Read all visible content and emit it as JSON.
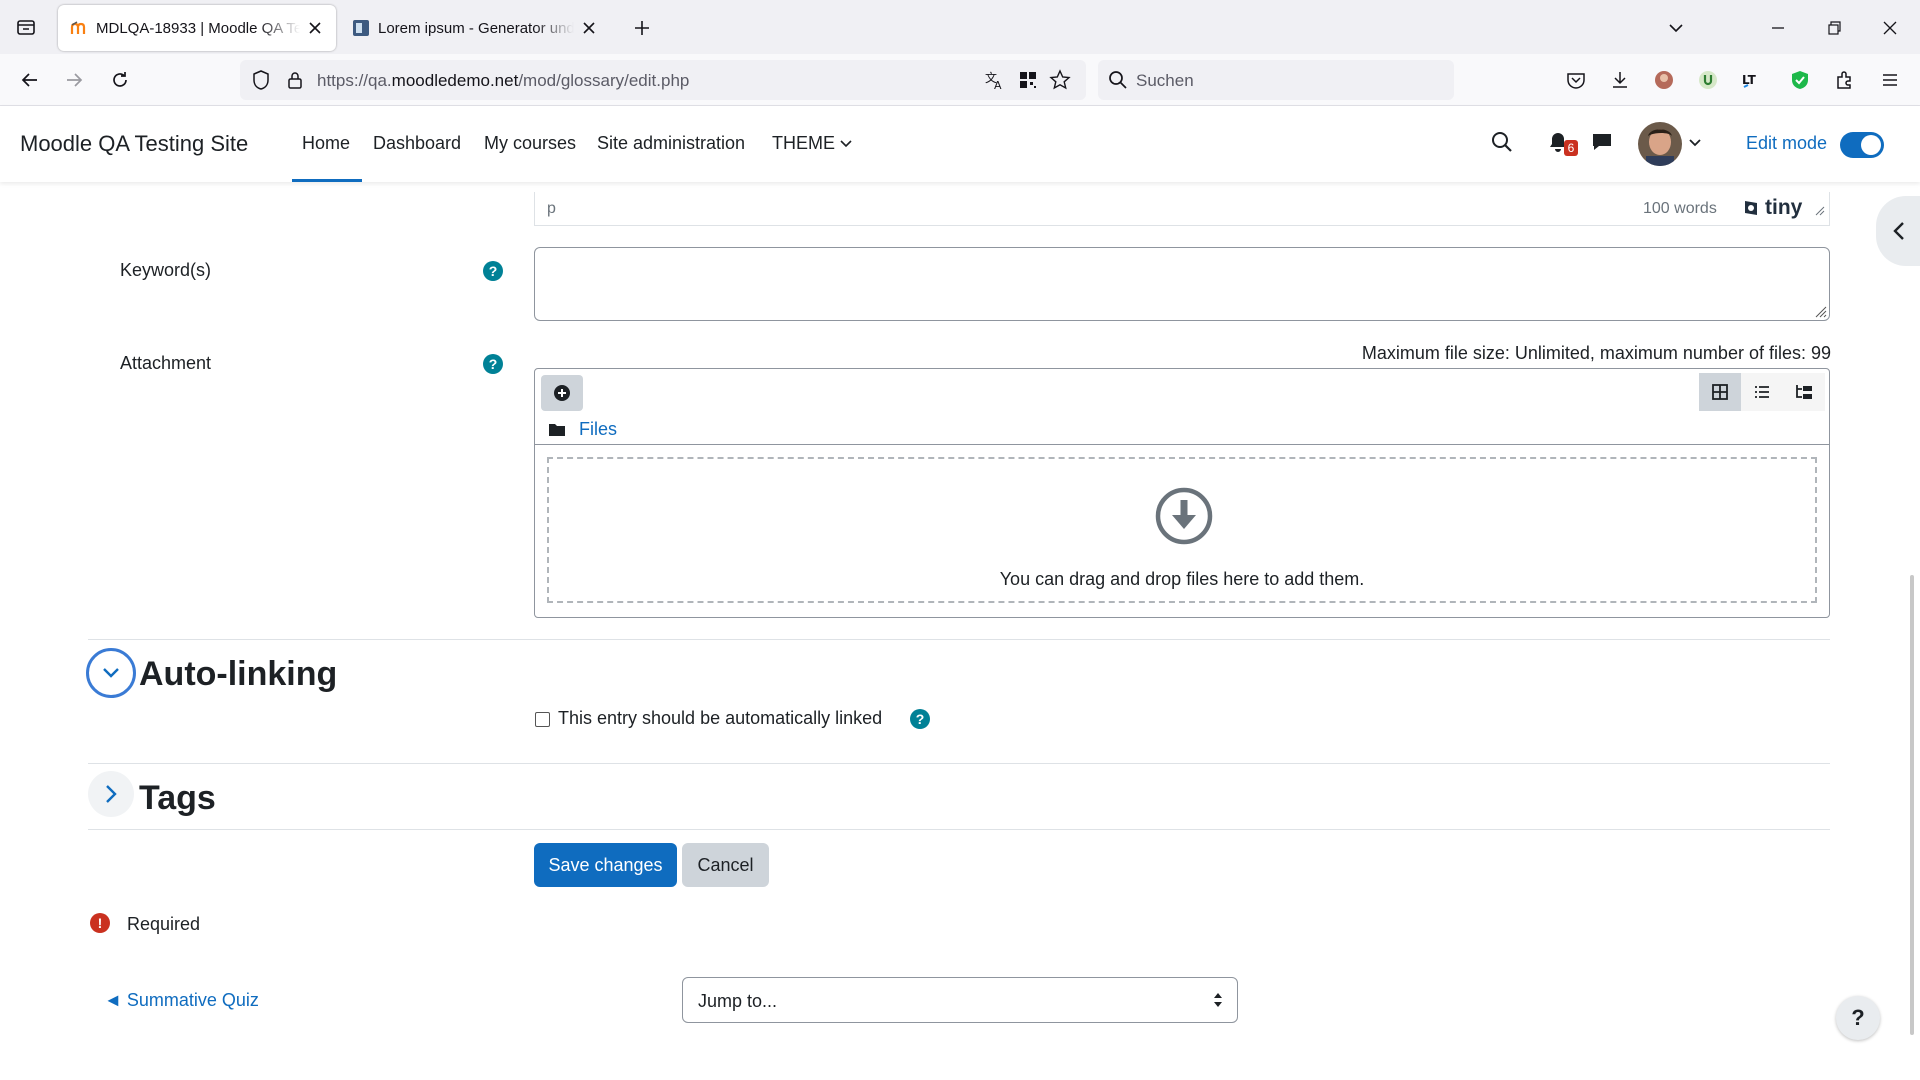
{
  "browser": {
    "tabs": [
      {
        "title": "MDLQA-18933 | Moodle QA Te",
        "active": true
      },
      {
        "title": "Lorem ipsum - Generator und I",
        "active": false
      }
    ],
    "url_prefix": "https://qa.",
    "url_domain": "moodledemo.net",
    "url_path": "/mod/glossary/edit.php",
    "search_placeholder": "Suchen"
  },
  "header": {
    "site_name": "Moodle QA Testing Site",
    "nav": [
      "Home",
      "Dashboard",
      "My courses",
      "Site administration",
      "THEME"
    ],
    "notification_count": "6",
    "edit_mode_label": "Edit mode",
    "edit_mode_on": true
  },
  "editor_footer": {
    "path": "p",
    "word_count": "100 words",
    "brand": "tiny"
  },
  "form": {
    "keywords_label": "Keyword(s)",
    "attachment_label": "Attachment",
    "file_limit": "Maximum file size: Unlimited, maximum number of files: 99",
    "files_folder": "Files",
    "dropzone_text": "You can drag and drop files here to add them.",
    "autolinking_title": "Auto-linking",
    "autolink_checkbox_label": "This entry should be automatically linked",
    "autolink_checked": false,
    "tags_title": "Tags",
    "save_label": "Save changes",
    "cancel_label": "Cancel",
    "required_label": "Required"
  },
  "footer_nav": {
    "prev_link": "◄ Summative Quiz",
    "jump_value": "Jump to..."
  },
  "colors": {
    "primary": "#0f6cbf",
    "help": "#008196",
    "required": "#ca3120"
  }
}
